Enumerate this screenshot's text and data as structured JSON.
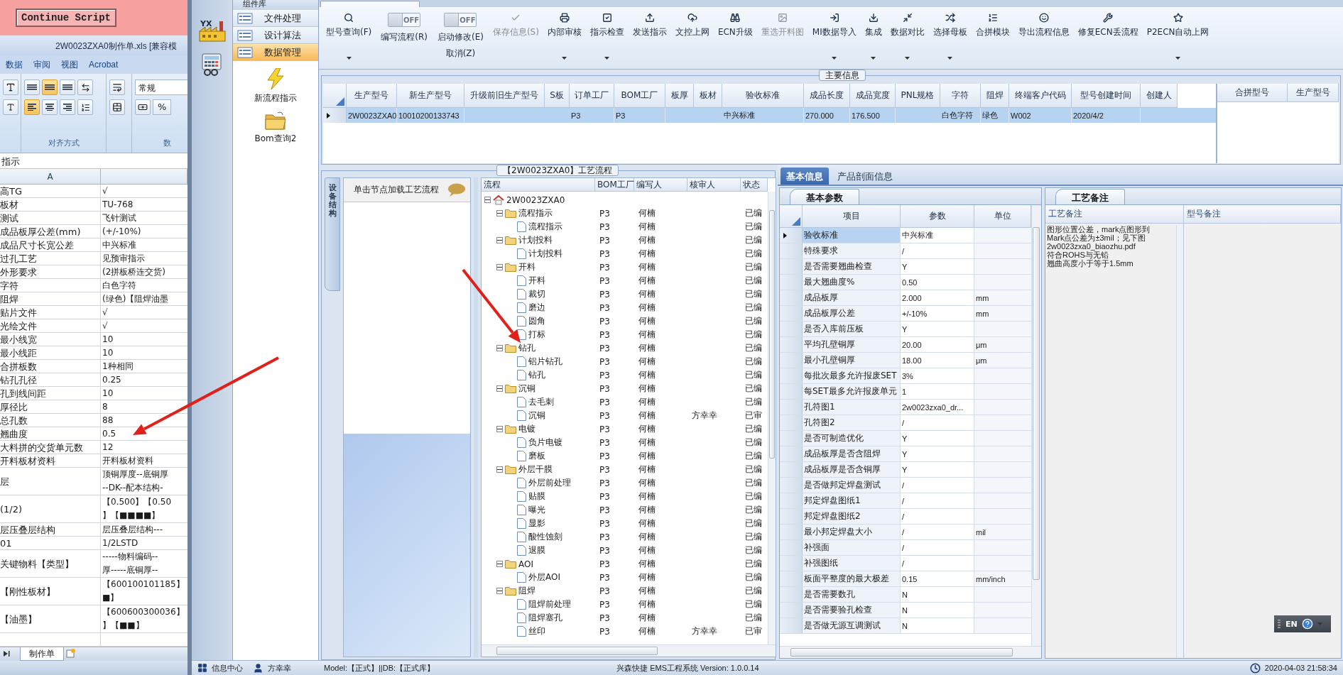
{
  "script_button": "Continue Script",
  "excel": {
    "title": "2W0023ZXA0制作单.xls  [兼容模",
    "ribbon_tabs": [
      "数据",
      "审阅",
      "视图",
      "Acrobat"
    ],
    "align_buttons": [
      {
        "kind": "top",
        "selected": false
      },
      {
        "kind": "middle",
        "selected": true
      },
      {
        "kind": "bottom",
        "selected": false
      },
      {
        "kind": "left",
        "selected": true
      },
      {
        "kind": "center",
        "selected": false
      },
      {
        "kind": "right",
        "selected": false
      }
    ],
    "align_group": "对齐方式",
    "number_format": "常规",
    "percent_button": "%",
    "number_group": "数",
    "formula_text": "指示",
    "column_header": "A",
    "rows": [
      {
        "a": "高TG",
        "b": [
          "√"
        ]
      },
      {
        "a": "板材",
        "b": [
          "TU-768"
        ]
      },
      {
        "a": "测试",
        "b": [
          "飞针测试"
        ]
      },
      {
        "a": "成品板厚公差(mm)",
        "b": [
          "(+/-10%)"
        ]
      },
      {
        "a": "成品尺寸长宽公差",
        "b": [
          "中兴标准"
        ]
      },
      {
        "a": "过孔工艺",
        "b": [
          "见预审指示"
        ]
      },
      {
        "a": "外形要求",
        "b": [
          "(2拼板桥连交货)"
        ]
      },
      {
        "a": "字符",
        "b": [
          "白色字符"
        ]
      },
      {
        "a": "阻焊",
        "b": [
          "(绿色)【阻焊油墨"
        ]
      },
      {
        "a": "贴片文件",
        "b": [
          "√"
        ]
      },
      {
        "a": "光绘文件",
        "b": [
          "√"
        ]
      },
      {
        "a": "最小线宽",
        "b": [
          "10"
        ]
      },
      {
        "a": "最小线距",
        "b": [
          "10"
        ]
      },
      {
        "a": "合拼板数",
        "b": [
          "1种相同"
        ]
      },
      {
        "a": "钻孔孔径",
        "b": [
          "0.25"
        ]
      },
      {
        "a": "孔到线间距",
        "b": [
          "10"
        ]
      },
      {
        "a": "厚径比",
        "b": [
          "8"
        ]
      },
      {
        "a": "总孔数",
        "b": [
          "88"
        ]
      },
      {
        "a": "翘曲度",
        "b": [
          "0.5"
        ]
      },
      {
        "a": "大料拼的交货单元数",
        "b": [
          "12"
        ]
      },
      {
        "a": "开料板材资料",
        "b": [
          "开料板材资料"
        ]
      },
      {
        "a": "层",
        "b": [
          "顶铜厚度--底铜厚",
          "--DK--配本结构-"
        ]
      },
      {
        "a": "(1/2)",
        "b": [
          "【0.500】【0.50",
          "】【■■■■】"
        ]
      },
      {
        "a": "层压叠层结构",
        "b": [
          "层压叠层结构---"
        ]
      },
      {
        "a": "01",
        "b": [
          "1/2LSTD"
        ]
      },
      {
        "a": "关键物料【类型】",
        "b": [
          "-----物料编码--",
          "厚-----底铜厚--"
        ]
      },
      {
        "a": "【刚性板材】",
        "b": [
          "【600100101185】",
          "■】"
        ]
      },
      {
        "a": "【油墨】",
        "b": [
          "【600600300036】",
          "】【■■】"
        ]
      }
    ],
    "sheet_tab": "制作单"
  },
  "nav": {
    "logo_text": "YX",
    "header": "组件库",
    "items": [
      {
        "label": "文件处理",
        "selected": false
      },
      {
        "label": "设计算法",
        "selected": false
      },
      {
        "label": "数据管理",
        "selected": true
      }
    ],
    "shortcuts": [
      {
        "label": "新流程指示",
        "kind": "bolt"
      },
      {
        "label": "Bom查询2",
        "kind": "folder"
      }
    ]
  },
  "toolbar": [
    {
      "kind": "button",
      "label": "型号查询(F)",
      "dropdown": true,
      "disabled": false
    },
    {
      "kind": "toggle",
      "label": "编写流程(R)",
      "toggle_text": "OFF",
      "on": false
    },
    {
      "kind": "toggle",
      "label": "启动修改(E)",
      "sublabel": "取消(Z)",
      "toggle_text": "OFF",
      "on": false
    },
    {
      "kind": "button",
      "label": "保存信息(S)",
      "dropdown": false,
      "disabled": true
    },
    {
      "kind": "button",
      "label": "内部审核",
      "dropdown": true,
      "disabled": false
    },
    {
      "kind": "button",
      "label": "指示检查",
      "dropdown": true,
      "disabled": false
    },
    {
      "kind": "button",
      "label": "发送指示",
      "dropdown": false,
      "disabled": false
    },
    {
      "kind": "button",
      "label": "文控上网",
      "dropdown": false,
      "disabled": false
    },
    {
      "kind": "button",
      "label": "ECN升级",
      "dropdown": false,
      "disabled": false
    },
    {
      "kind": "button",
      "label": "重选开料图",
      "dropdown": false,
      "disabled": true
    },
    {
      "kind": "button",
      "label": "MI数据导入",
      "dropdown": true,
      "disabled": false
    },
    {
      "kind": "button",
      "label": "集成",
      "dropdown": true,
      "disabled": false
    },
    {
      "kind": "button",
      "label": "数据对比",
      "dropdown": true,
      "disabled": false
    },
    {
      "kind": "button",
      "label": "选择母板",
      "dropdown": true,
      "disabled": false
    },
    {
      "kind": "button",
      "label": "合拼模块",
      "dropdown": false,
      "disabled": false
    },
    {
      "kind": "button",
      "label": "导出流程信息",
      "dropdown": false,
      "disabled": false
    },
    {
      "kind": "button",
      "label": "修复ECN丢流程",
      "dropdown": false,
      "disabled": false
    },
    {
      "kind": "button",
      "label": "P2ECN自动上网",
      "dropdown": true,
      "disabled": false
    }
  ],
  "main_info": {
    "legend": "主要信息",
    "columns": [
      "生产型号",
      "新生产型号",
      "升级前旧生产型号",
      "S板",
      "订单工厂",
      "BOM工厂",
      "板厚",
      "板材",
      "验收标准",
      "成品长度",
      "成品宽度",
      "PNL规格",
      "字符",
      "阻焊",
      "终端客户代码",
      "型号创建时间",
      "创建人"
    ],
    "rows": [
      {
        "selected": true,
        "cells": [
          "2W0023ZXA0",
          "10010200133743",
          null,
          null,
          "P3",
          "P3",
          null,
          null,
          "中兴标准",
          "270.000",
          "176.500",
          null,
          "白色字符",
          "绿色",
          "W002",
          "2020/4/2",
          null
        ]
      }
    ]
  },
  "merge_table": {
    "columns": [
      "合拼型号",
      "生产型号"
    ]
  },
  "process": {
    "legend": "【2W0023ZXA0】工艺流程",
    "side_tab": "设备结构",
    "hint": "单击节点加载工艺流程",
    "columns": [
      "流程",
      "BOM工厂",
      "编写人",
      "核审人",
      "状态"
    ],
    "tree": [
      {
        "label": "2W0023ZXA0",
        "expanded": true,
        "children": [
          {
            "label": "流程指示",
            "bom": "P3",
            "writer": "何楠",
            "status": "已编",
            "expanded": true,
            "children": [
              {
                "label": "流程指示",
                "bom": "P3",
                "writer": "何楠",
                "status": "已编"
              }
            ]
          },
          {
            "label": "计划投料",
            "bom": "P3",
            "writer": "何楠",
            "status": "已编",
            "expanded": true,
            "children": [
              {
                "label": "计划投料",
                "bom": "P3",
                "writer": "何楠",
                "status": "已编"
              }
            ]
          },
          {
            "label": "开料",
            "bom": "P3",
            "writer": "何楠",
            "status": "已编",
            "expanded": true,
            "children": [
              {
                "label": "开料",
                "bom": "P3",
                "writer": "何楠",
                "status": "已编"
              },
              {
                "label": "裁切",
                "bom": "P3",
                "writer": "何楠",
                "status": "已编"
              },
              {
                "label": "磨边",
                "bom": "P3",
                "writer": "何楠",
                "status": "已编"
              },
              {
                "label": "圆角",
                "bom": "P3",
                "writer": "何楠",
                "status": "已编"
              },
              {
                "label": "打标",
                "bom": "P3",
                "writer": "何楠",
                "status": "已编"
              }
            ]
          },
          {
            "label": "钻孔",
            "bom": "P3",
            "writer": "何楠",
            "status": "已编",
            "expanded": true,
            "children": [
              {
                "label": "铝片钻孔",
                "bom": "P3",
                "writer": "何楠",
                "status": "已编"
              },
              {
                "label": "钻孔",
                "bom": "P3",
                "writer": "何楠",
                "status": "已编"
              }
            ]
          },
          {
            "label": "沉铜",
            "bom": "P3",
            "writer": "何楠",
            "status": "已编",
            "expanded": true,
            "children": [
              {
                "label": "去毛刺",
                "bom": "P3",
                "writer": "何楠",
                "status": "已编"
              },
              {
                "label": "沉铜",
                "bom": "P3",
                "writer": "何楠",
                "reviewer": "方幸幸",
                "status": "已审"
              }
            ]
          },
          {
            "label": "电镀",
            "bom": "P3",
            "writer": "何楠",
            "status": "已编",
            "expanded": true,
            "children": [
              {
                "label": "负片电镀",
                "bom": "P3",
                "writer": "何楠",
                "status": "已编"
              },
              {
                "label": "磨板",
                "bom": "P3",
                "writer": "何楠",
                "status": "已编"
              }
            ]
          },
          {
            "label": "外层干膜",
            "bom": "P3",
            "writer": "何楠",
            "status": "已编",
            "expanded": true,
            "children": [
              {
                "label": "外层前处理",
                "bom": "P3",
                "writer": "何楠",
                "status": "已编"
              },
              {
                "label": "贴膜",
                "bom": "P3",
                "writer": "何楠",
                "status": "已编"
              },
              {
                "label": "曝光",
                "bom": "P3",
                "writer": "何楠",
                "status": "已编"
              },
              {
                "label": "显影",
                "bom": "P3",
                "writer": "何楠",
                "status": "已编"
              },
              {
                "label": "酸性蚀刻",
                "bom": "P3",
                "writer": "何楠",
                "status": "已编"
              },
              {
                "label": "退膜",
                "bom": "P3",
                "writer": "何楠",
                "status": "已编"
              }
            ]
          },
          {
            "label": "AOI",
            "bom": "P3",
            "writer": "何楠",
            "status": "已编",
            "expanded": true,
            "children": [
              {
                "label": "外层AOI",
                "bom": "P3",
                "writer": "何楠",
                "status": "已编"
              }
            ]
          },
          {
            "label": "阻焊",
            "bom": "P3",
            "writer": "何楠",
            "status": "已编",
            "expanded": true,
            "children": [
              {
                "label": "阻焊前处理",
                "bom": "P3",
                "writer": "何楠",
                "status": "已编"
              },
              {
                "label": "阻焊塞孔",
                "bom": "P3",
                "writer": "何楠",
                "status": "已编"
              },
              {
                "label": "丝印",
                "bom": "P3",
                "writer": "何楠",
                "reviewer": "方幸幸",
                "status": "已审"
              }
            ]
          }
        ]
      }
    ]
  },
  "detail": {
    "tabs": [
      {
        "label": "基本信息",
        "selected": true
      },
      {
        "label": "产品剖面信息",
        "selected": false
      }
    ],
    "params": {
      "tab": "基本参数",
      "columns": [
        "项目",
        "参数",
        "单位"
      ],
      "rows": [
        {
          "item": "验收标准",
          "value": "中兴标准",
          "selected": true
        },
        {
          "item": "特殊要求",
          "value": "/",
          "selected": false
        },
        {
          "item": "是否需要翘曲检查",
          "value": "Y",
          "selected": false
        },
        {
          "item": "最大翘曲度%",
          "value": "0.50",
          "selected": false
        },
        {
          "item": "成品板厚",
          "value": "2.000",
          "unit": "mm",
          "selected": false
        },
        {
          "item": "成品板厚公差",
          "value": "+/-10%",
          "unit": "mm",
          "selected": false
        },
        {
          "item": "是否入库前压板",
          "value": "Y",
          "selected": false
        },
        {
          "item": "平均孔壁铜厚",
          "value": "20.00",
          "unit": "μm",
          "selected": false
        },
        {
          "item": "最小孔壁铜厚",
          "value": "18.00",
          "unit": "μm",
          "selected": false
        },
        {
          "item": "每批次最多允许报废SET",
          "value": "3%",
          "selected": false
        },
        {
          "item": "每SET最多允许报废单元",
          "value": "1",
          "selected": false
        },
        {
          "item": "孔符图1",
          "value": "2w0023zxa0_dr...",
          "selected": false
        },
        {
          "item": "孔符图2",
          "value": "/",
          "selected": false
        },
        {
          "item": "是否可制造优化",
          "value": "Y",
          "selected": false
        },
        {
          "item": "成品板厚是否含阻焊",
          "value": "Y",
          "selected": false
        },
        {
          "item": "成品板厚是否含铜厚",
          "value": "Y",
          "selected": false
        },
        {
          "item": "是否做邦定焊盘测试",
          "value": "/",
          "selected": false
        },
        {
          "item": "邦定焊盘图纸1",
          "value": "/",
          "selected": false
        },
        {
          "item": "邦定焊盘图纸2",
          "value": "/",
          "selected": false
        },
        {
          "item": "最小邦定焊盘大小",
          "value": "/",
          "unit": "mil",
          "selected": false
        },
        {
          "item": "补强面",
          "value": "/",
          "selected": false
        },
        {
          "item": "补强图纸",
          "value": "/",
          "selected": false
        },
        {
          "item": "板面平整度的最大极差",
          "value": "0.15",
          "unit": "mm/inch",
          "selected": false
        },
        {
          "item": "是否需要数孔",
          "value": "N",
          "selected": false
        },
        {
          "item": "是否需要验孔检查",
          "value": "N",
          "selected": false
        },
        {
          "item": "是否做无源互调测试",
          "value": "N",
          "selected": false
        }
      ]
    },
    "notes": {
      "tab": "工艺备注",
      "columns": [
        "工艺备注",
        "型号备注"
      ],
      "lines": [
        "图形位置公差，mark点图形到",
        "Mark点公差为±3mil；见下图",
        "2w0023zxa0_biaozhu.pdf",
        "符合ROHS与无铅",
        "翘曲高度小于等于1.5mm"
      ]
    }
  },
  "ime": {
    "label": "EN"
  },
  "status_bar": {
    "info": "信息中心",
    "user": "方幸幸",
    "model": "Model:【正式】||DB:【正式库】",
    "version": "兴森快捷 EMS工程系统 Version: 1.0.0.14",
    "datetime": "2020-04-03 21:58:34"
  }
}
